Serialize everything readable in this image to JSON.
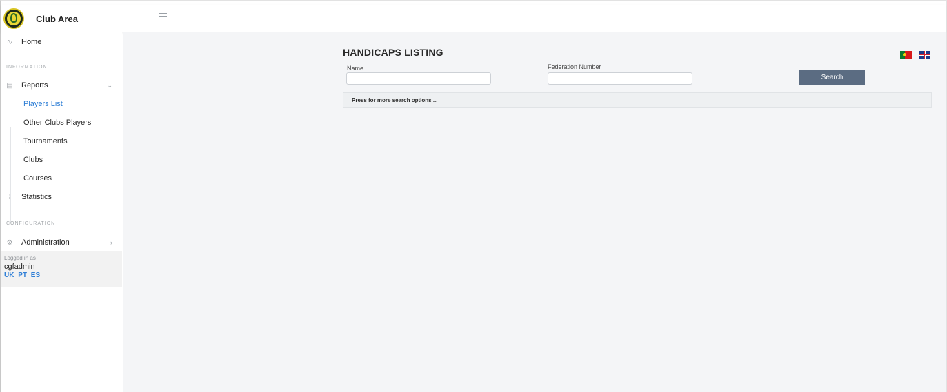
{
  "app": {
    "title": "Club Area"
  },
  "sidebar": {
    "home": "Home",
    "information_label": "INFORMATION",
    "reports": "Reports",
    "reports_items": [
      {
        "label": "Players List",
        "active": true
      },
      {
        "label": "Other Clubs Players",
        "active": false
      },
      {
        "label": "Tournaments",
        "active": false
      },
      {
        "label": "Clubs",
        "active": false
      },
      {
        "label": "Courses",
        "active": false
      }
    ],
    "statistics": "Statistics",
    "configuration_label": "CONFIGURATION",
    "administration": "Administration",
    "login": {
      "label": "Logged in as",
      "user": "cgfadmin",
      "languages": [
        "UK",
        "PT",
        "ES"
      ]
    }
  },
  "main": {
    "title": "HANDICAPS LISTING",
    "name_label": "Name",
    "name_value": "",
    "federation_label": "Federation Number",
    "federation_value": "",
    "search_button": "Search",
    "more_options": "Press for more search options ...",
    "flags": [
      "portugal-flag",
      "uk-flag"
    ]
  },
  "colors": {
    "accent": "#2f7fd6",
    "button": "#5b6c82",
    "main_bg": "#f4f5f7"
  }
}
